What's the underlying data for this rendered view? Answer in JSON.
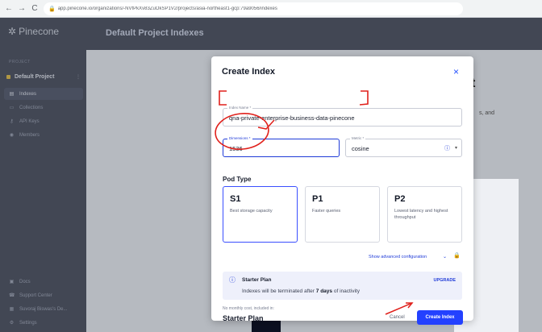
{
  "browser": {
    "back": "←",
    "forward": "→",
    "reload": "C",
    "url": "app.pinecone.io/organizations/-NVfPkXv83ZuOkSP1V2/projects/asia-northeast1-gcp:79a9056/indexes"
  },
  "sidebar": {
    "logo": "Pinecone",
    "section_label": "PROJECT",
    "project_name": "Default Project",
    "nav": [
      {
        "label": "Indexes",
        "icon": "database-icon"
      },
      {
        "label": "Collections",
        "icon": "collection-icon"
      },
      {
        "label": "API Keys",
        "icon": "key-icon"
      },
      {
        "label": "Members",
        "icon": "members-icon"
      }
    ],
    "bottom": [
      {
        "label": "Docs",
        "icon": "docs-icon"
      },
      {
        "label": "Support Center",
        "icon": "support-icon"
      },
      {
        "label": "Suvoraj Biswas's De...",
        "icon": "org-icon"
      },
      {
        "label": "Settings",
        "icon": "settings-icon"
      }
    ]
  },
  "header": {
    "title": "Default Project Indexes"
  },
  "background": {
    "partial_heading": "t",
    "partial_text": "s, and"
  },
  "modal": {
    "title": "Create Index",
    "close": "×",
    "index_name": {
      "label": "Index Name *",
      "value": "qna-private-enterprise-business-data-pinecone"
    },
    "dimensions": {
      "label": "Dimensions *",
      "value": "1536"
    },
    "metric": {
      "label": "Metric *",
      "value": "cosine"
    },
    "pod_type_heading": "Pod Type",
    "pods": [
      {
        "name": "S1",
        "desc": "Best storage capacity",
        "selected": true
      },
      {
        "name": "P1",
        "desc": "Faster queries",
        "selected": false
      },
      {
        "name": "P2",
        "desc": "Lowest latency and highest throughput",
        "selected": false
      }
    ],
    "advanced": "Show advanced configuration",
    "plan": {
      "name": "Starter Plan",
      "upgrade": "UPGRADE",
      "note_prefix": "Indexes will be terminated after ",
      "note_bold": "7 days",
      "note_suffix": " of inactivity"
    },
    "cost_label": "No monthly cost, included in:",
    "cost_plan": "Starter Plan",
    "cancel": "Cancel",
    "create": "Create Index"
  },
  "colors": {
    "accent": "#2341ff",
    "sidebar_bg": "#0c1021",
    "annotation": "#e0201b"
  }
}
